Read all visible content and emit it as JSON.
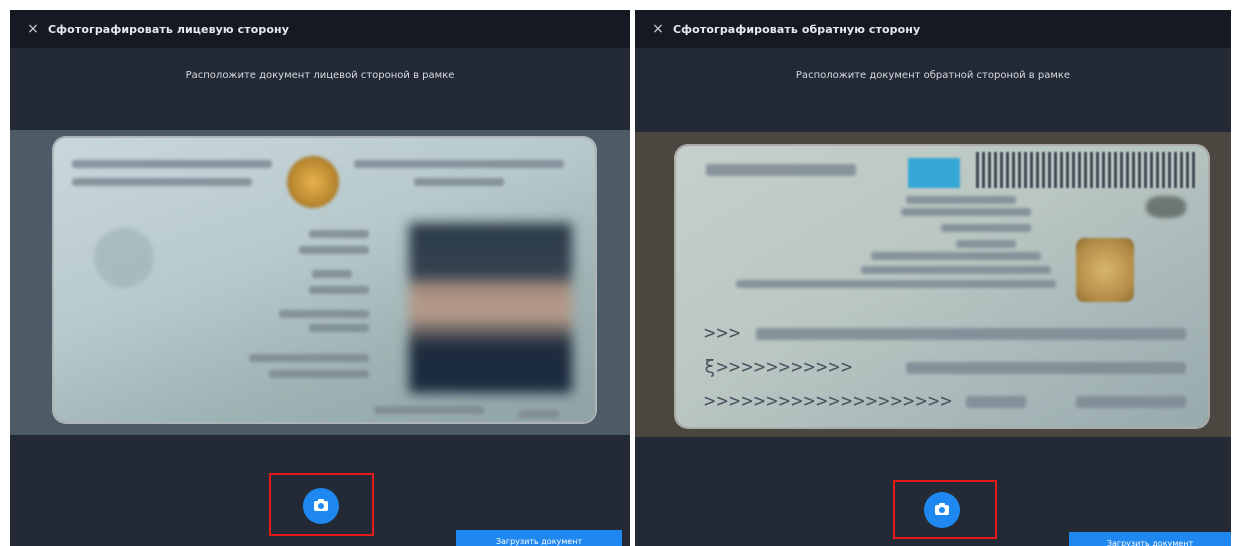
{
  "screens": [
    {
      "title": "Сфотографировать лицевую сторону",
      "hint": "Расположите документ лицевой стороной в рамке",
      "upload_label": "Загрузить документ"
    },
    {
      "title": "Сфотографировать обратную сторону",
      "hint": "Расположите документ обратной стороной в рамке",
      "upload_label": "Загрузить документ",
      "mrz_lines": [
        ">>>",
        "ξ>>>>>>>>>>>",
        ">>>>>>>>>>>>>>>>>>>>"
      ]
    }
  ],
  "icons": {
    "close": "×",
    "close_name": "close-icon",
    "camera_name": "camera-icon"
  },
  "colors": {
    "accent": "#1e88f0",
    "highlight": "#e31b1b",
    "topbar": "#141922",
    "panel": "#232a36"
  }
}
